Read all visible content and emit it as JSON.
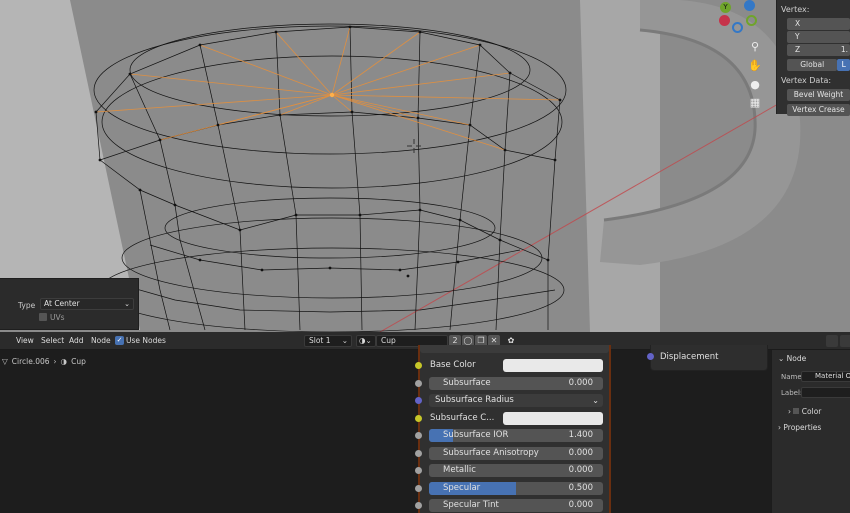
{
  "viewport": {
    "n_panel": {
      "vertex_header": "Vertex:",
      "x_label": "X",
      "y_label": "Y",
      "z_label": "Z",
      "z_value": "1.",
      "global_label": "Global",
      "local_label": "L",
      "vertex_data_header": "Vertex Data:",
      "bevel_weight_label": "Bevel Weight",
      "vertex_crease_label": "Vertex Crease"
    },
    "gizmo": {
      "x_axis_color": "#c6334a",
      "y_axis_color": "#6fa42b",
      "z_axis_color": "#3478c6",
      "y_label": "Y"
    },
    "nav_icons": [
      "zoom-icon",
      "hand-icon",
      "camera-icon",
      "grid-icon"
    ]
  },
  "operator_panel": {
    "type_label": "Type",
    "type_value": "At Center",
    "uvs_label": "UVs"
  },
  "node_header": {
    "menus": [
      "View",
      "Select",
      "Add",
      "Node"
    ],
    "use_nodes_label": "Use Nodes",
    "slot_value": "Slot 1",
    "material_name": "Cup",
    "user_count": "2"
  },
  "breadcrumb": {
    "object_name": "Circle.006",
    "material_name": "Cup"
  },
  "bsdf_rows": [
    {
      "type": "color",
      "label": "Base Color",
      "socket": "yellow"
    },
    {
      "type": "value",
      "label": "Subsurface",
      "value": "0.000",
      "fill": 0,
      "socket": "grey"
    },
    {
      "type": "dropdown",
      "label": "Subsurface Radius",
      "socket": "blue"
    },
    {
      "type": "color",
      "label": "Subsurface C...",
      "socket": "yellow"
    },
    {
      "type": "value",
      "label": "Subsurface IOR",
      "value": "1.400",
      "fill": 0.14,
      "socket": "grey"
    },
    {
      "type": "value",
      "label": "Subsurface Anisotropy",
      "value": "0.000",
      "fill": 0,
      "socket": "grey"
    },
    {
      "type": "value",
      "label": "Metallic",
      "value": "0.000",
      "fill": 0,
      "socket": "grey"
    },
    {
      "type": "value",
      "label": "Specular",
      "value": "0.500",
      "fill": 0.5,
      "socket": "grey"
    },
    {
      "type": "value",
      "label": "Specular Tint",
      "value": "0.000",
      "fill": 0,
      "socket": "grey"
    }
  ],
  "displacement_node": {
    "label": "Displacement"
  },
  "properties_panel": {
    "node_section": "Node",
    "name_label": "Name:",
    "name_value": "Material O",
    "label_label": "Label:",
    "color_section": "Color",
    "properties_section": "Properties"
  },
  "colors": {
    "accent_blue": "#4772b3",
    "wire_orange": "#e8903a",
    "viewport_bg": "#8c8c8c"
  }
}
